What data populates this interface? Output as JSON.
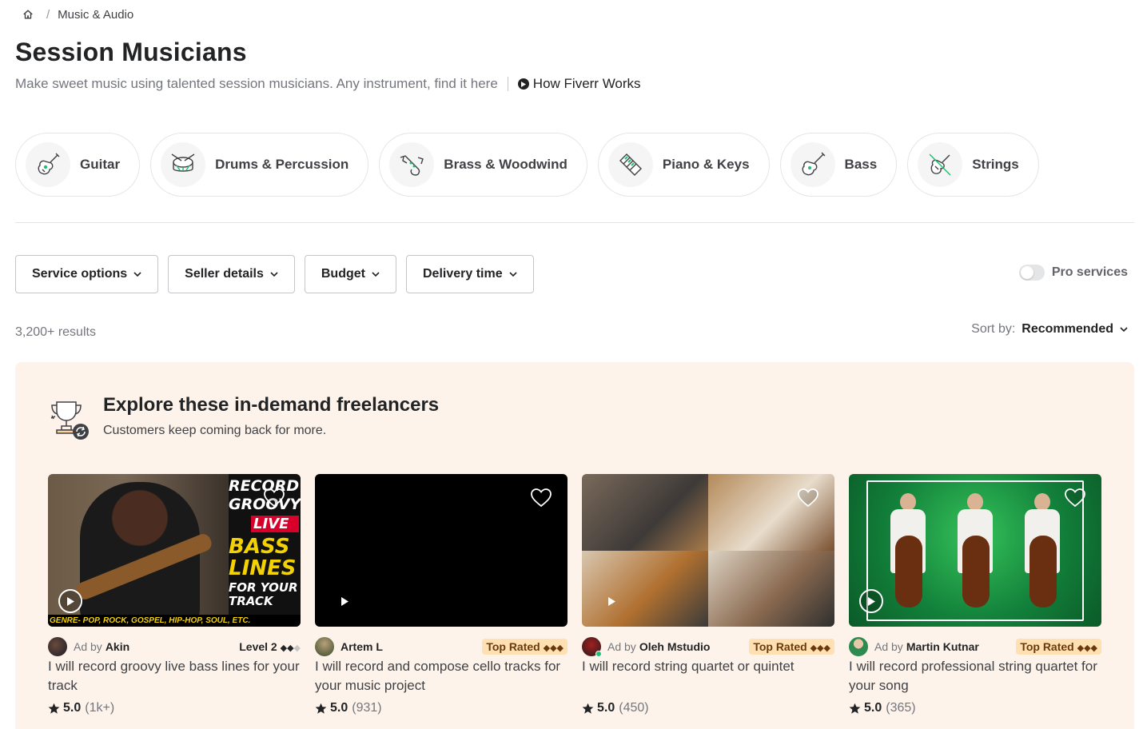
{
  "breadcrumb": {
    "home_icon": "home-icon",
    "separator": "/",
    "current": "Music & Audio"
  },
  "header": {
    "title": "Session Musicians",
    "subtitle": "Make sweet music using talented session musicians. Any instrument, find it here",
    "how_link": "How Fiverr Works"
  },
  "categories": [
    {
      "label": "Guitar",
      "icon": "guitar-icon"
    },
    {
      "label": "Drums & Percussion",
      "icon": "drum-icon"
    },
    {
      "label": "Brass & Woodwind",
      "icon": "saxophone-icon"
    },
    {
      "label": "Piano & Keys",
      "icon": "piano-icon"
    },
    {
      "label": "Bass",
      "icon": "bass-guitar-icon"
    },
    {
      "label": "Strings",
      "icon": "violin-icon"
    }
  ],
  "filters": {
    "service_options": "Service options",
    "seller_details": "Seller details",
    "budget": "Budget",
    "delivery_time": "Delivery time",
    "pro_services": "Pro services"
  },
  "results": {
    "count": "3,200+ results",
    "sort_label": "Sort by:",
    "sort_value": "Recommended"
  },
  "promo": {
    "title": "Explore these in-demand freelancers",
    "subtitle": "Customers keep coming back for more.",
    "cards": [
      {
        "ad": "Ad by",
        "seller": "Akin",
        "badge": "Level 2",
        "badge_type": "level",
        "title": "I will record groovy live bass lines for your track",
        "score": "5.0",
        "count": "(1k+)",
        "thumb_lines": [
          "RECORD",
          "GROOVY",
          "LIVE",
          "BASS",
          "LINES",
          "FOR YOUR",
          "TRACK"
        ],
        "thumb_strip": "GENRE- POP, ROCK, GOSPEL, HIP-HOP, SOUL, ETC."
      },
      {
        "ad": "",
        "seller": "Artem L",
        "badge": "Top Rated",
        "badge_type": "top",
        "title": "I will record and compose cello tracks for your music project",
        "score": "5.0",
        "count": "(931)"
      },
      {
        "ad": "Ad by",
        "seller": "Oleh Mstudio",
        "badge": "Top Rated",
        "badge_type": "top",
        "title": "I will record string quartet or quintet",
        "score": "5.0",
        "count": "(450)"
      },
      {
        "ad": "Ad by",
        "seller": "Martin Kutnar",
        "badge": "Top Rated",
        "badge_type": "top",
        "title": "I will record professional string quartet for your song",
        "score": "5.0",
        "count": "(365)"
      }
    ]
  },
  "colors": {
    "brand_green": "#1dbf73",
    "promo_bg": "#fdf3ea",
    "top_rated_bg": "#ffe0b3"
  }
}
